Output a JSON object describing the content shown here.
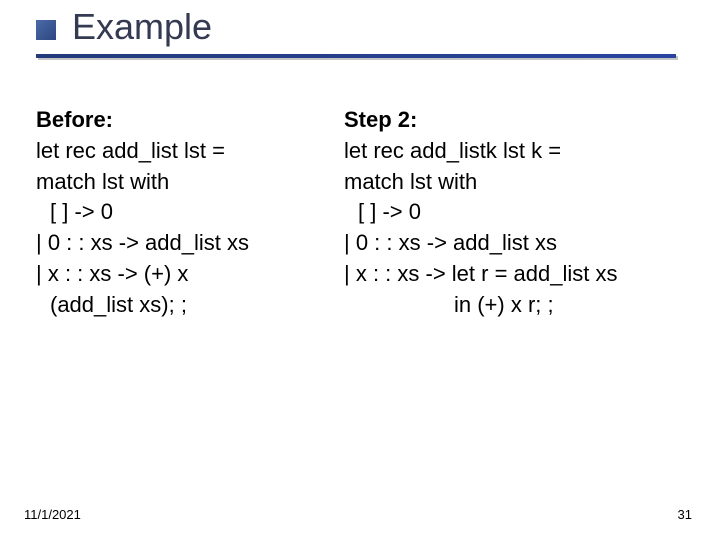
{
  "slide": {
    "title": "Example"
  },
  "left": {
    "heading": "Before:",
    "l1": "let rec add_list lst =",
    "l2": "match lst with",
    "l3": "[ ] -> 0",
    "l4": "| 0 : : xs -> add_list xs",
    "l5": "| x : : xs -> (+) x",
    "l6": "(add_list xs); ;"
  },
  "right": {
    "heading": "Step 2:",
    "l1": "let rec add_listk lst k =",
    "l2": "match lst with",
    "l3": "[ ] -> 0",
    "l4": "| 0 : : xs -> add_list xs",
    "l5": "| x : : xs -> let r = add_list xs",
    "l6": "in (+) x r; ;"
  },
  "footer": {
    "date": "11/1/2021",
    "page": "31"
  }
}
